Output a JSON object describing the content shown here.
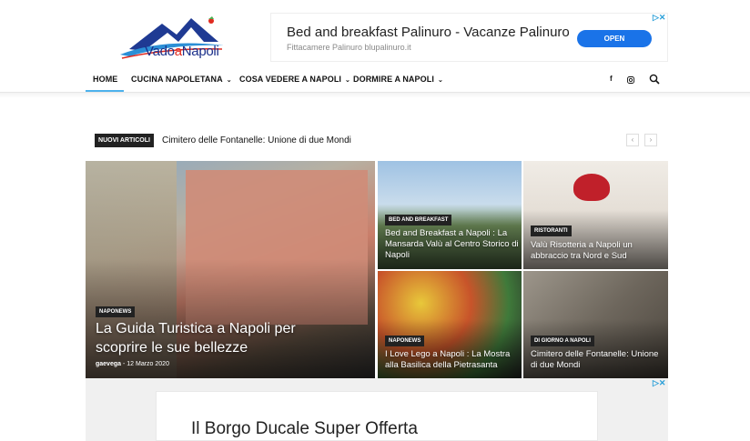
{
  "header": {
    "logo_part1": "Vado",
    "logo_a": "a",
    "logo_part2": "Napoli"
  },
  "ad_top": {
    "title": "Bed and breakfast Palinuro - Vacanze Palinuro",
    "subtitle": "Fittacamere Palinuro blupalinuro.it",
    "button": "OPEN"
  },
  "nav": {
    "items": [
      {
        "label": "HOME"
      },
      {
        "label": "CUCINA NAPOLETANA"
      },
      {
        "label": "COSA VEDERE A NAPOLI"
      },
      {
        "label": "DORMIRE A NAPOLI"
      }
    ],
    "caret": "⌄"
  },
  "ticker": {
    "label": "NUOVI ARTICOLI",
    "text": "Cimitero delle Fontanelle: Unione di due Mondi",
    "prev": "‹",
    "next": "›"
  },
  "featured": {
    "big": {
      "category": "NAPONEWS",
      "title": "La Guida Turistica a Napoli per scoprire le sue bellezze",
      "author": "gaevega",
      "date": "12 Marzo 2020"
    },
    "tiles": [
      {
        "category": "BED AND BREAKFAST",
        "title": "Bed and Breakfast a Napoli : La Mansarda Valù al Centro Storico di Napoli"
      },
      {
        "category": "RISTORANTI",
        "title": "Valù Risotteria a Napoli un abbraccio tra Nord e Sud"
      },
      {
        "category": "NAPONEWS",
        "title": "I Love Lego a Napoli : La Mostra alla Basilica della Pietrasanta"
      },
      {
        "category": "DI GIORNO A NAPOLI",
        "title": "Cimitero delle Fontanelle: Unione di due Mondi"
      }
    ]
  },
  "ad_bottom": {
    "title": "Il Borgo Ducale Super Offerta"
  },
  "colors": {
    "accent": "#4db2ec",
    "ad_button": "#1a73e8",
    "logo_blue": "#1a2f8a"
  }
}
